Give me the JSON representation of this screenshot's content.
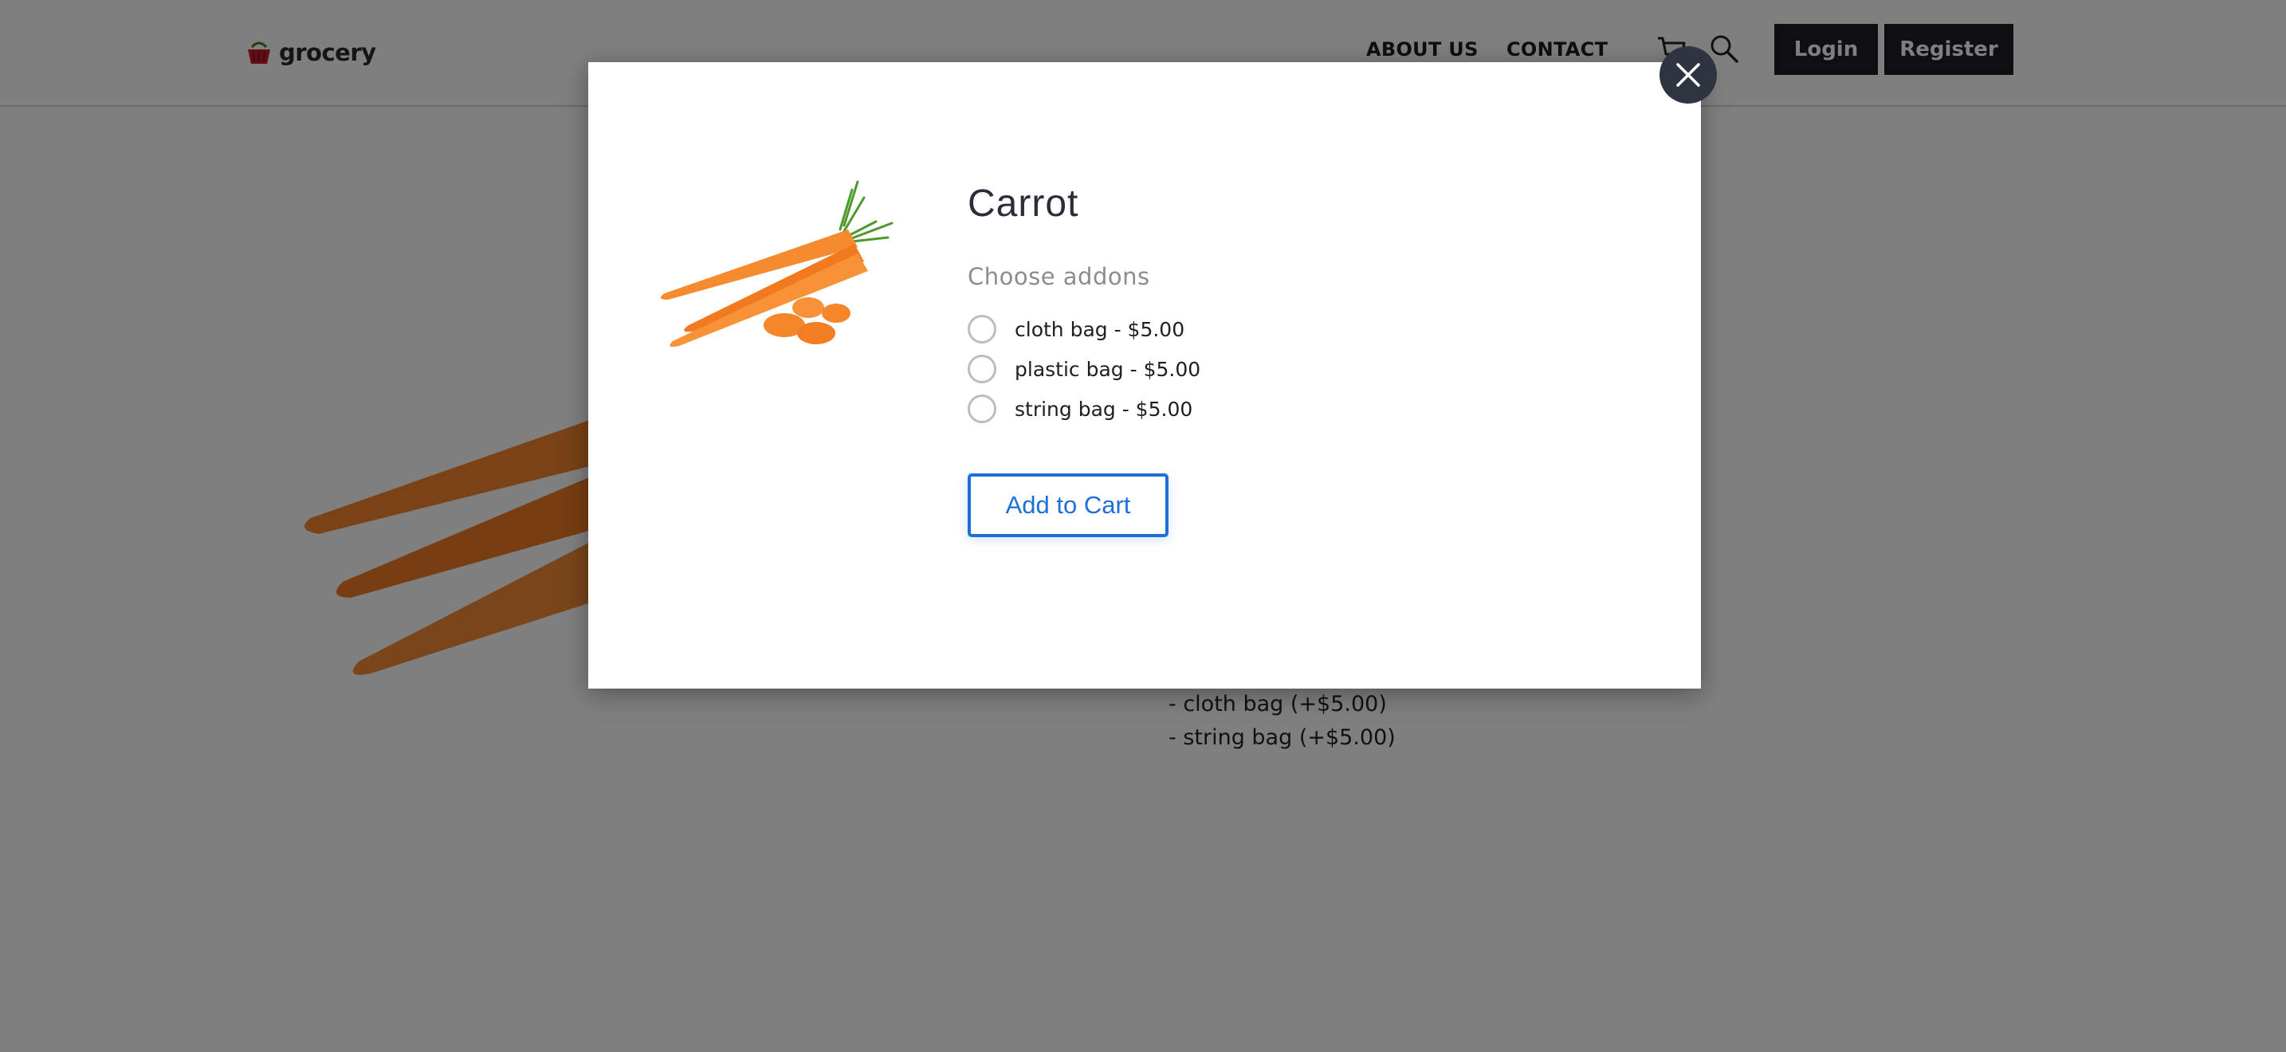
{
  "header": {
    "logo_text": "grocery",
    "nav": {
      "about": "ABOUT US",
      "contact": "CONTACT"
    },
    "icons": {
      "cart": "cart-icon",
      "search": "search-icon"
    },
    "login_label": "Login",
    "register_label": "Register"
  },
  "background_page": {
    "selected_addons": [
      "- cloth bag (+$5.00)",
      "- string bag (+$5.00)"
    ]
  },
  "modal": {
    "product_title": "Carrot",
    "addons_heading": "Choose addons",
    "addons": [
      {
        "label": "cloth bag - $5.00",
        "selected": false
      },
      {
        "label": "plastic bag - $5.00",
        "selected": false
      },
      {
        "label": "string bag - $5.00",
        "selected": false
      }
    ],
    "add_to_cart_label": "Add to Cart",
    "close_icon": "close-icon"
  },
  "colors": {
    "header_button_bg": "#1e1f27",
    "accent_blue": "#1f6fd8",
    "overlay": "rgba(0,0,0,0.5)",
    "carrot_orange": "#f5822a"
  }
}
